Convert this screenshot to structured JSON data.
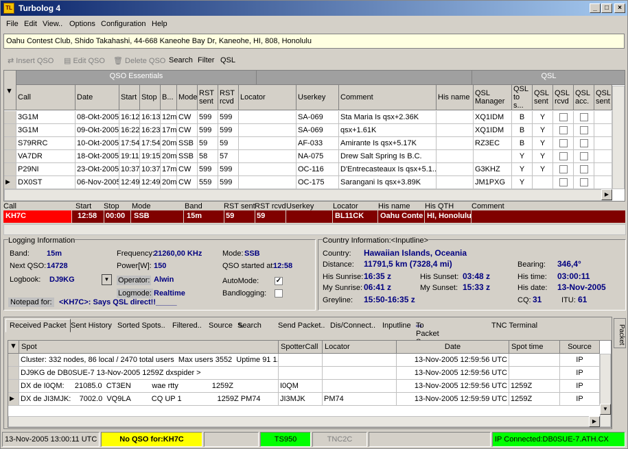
{
  "window": {
    "title": "Turbolog 4",
    "icon": "turbolog-app-icon",
    "minimize": "_",
    "maximize": "□",
    "close": "×"
  },
  "menu": [
    "File",
    "Edit",
    "View..",
    "Options",
    "Configuration",
    "Help"
  ],
  "address": "Oahu Contest Club, Shido Takahashi, 44-668 Kaneohe Bay Dr, Kaneohe, HI, 808, Honolulu",
  "toolbar": {
    "insert": "Insert QSO",
    "edit": "Edit QSO",
    "delete": "Delete QSO",
    "search": "Search",
    "filter": "Filter",
    "qsl": "QSL"
  },
  "qso_grid": {
    "groups": {
      "essentials": "QSO Essentials",
      "qsl": "QSL"
    },
    "columns": [
      "Call",
      "Date",
      "Start",
      "Stop",
      "B...",
      "Mode",
      "RST sent",
      "RST rcvd",
      "Locator",
      "Userkey",
      "Comment",
      "His name",
      "QSL Manager",
      "QSL to s...",
      "QSL sent",
      "QSL rcvd",
      "QSL acc.",
      "QSL sent"
    ],
    "rows": [
      {
        "call": "3G1M",
        "date": "08-Okt-2005",
        "start": "16:12",
        "stop": "16:13",
        "band": "12m",
        "mode": "CW",
        "rsts": "599",
        "rstr": "599",
        "loc": "",
        "userkey": "SA-069",
        "comment": "Sta Maria Is qsx+2.36K",
        "name": "",
        "mgr": "XQ1IDM",
        "qto": "B",
        "qsent": "Y"
      },
      {
        "call": "3G1M",
        "date": "09-Okt-2005",
        "start": "16:22",
        "stop": "16:23",
        "band": "17m",
        "mode": "CW",
        "rsts": "599",
        "rstr": "599",
        "loc": "",
        "userkey": "SA-069",
        "comment": "qsx+1.61K",
        "name": "",
        "mgr": "XQ1IDM",
        "qto": "B",
        "qsent": "Y"
      },
      {
        "call": "S79RRC",
        "date": "10-Okt-2005",
        "start": "17:54",
        "stop": "17:54",
        "band": "20m",
        "mode": "SSB",
        "rsts": "59",
        "rstr": "59",
        "loc": "",
        "userkey": "AF-033",
        "comment": "Amirante Is qsx+5.17K",
        "name": "",
        "mgr": "RZ3EC",
        "qto": "B",
        "qsent": "Y"
      },
      {
        "call": "VA7DR",
        "date": "18-Okt-2005",
        "start": "19:11",
        "stop": "19:15",
        "band": "20m",
        "mode": "SSB",
        "rsts": "58",
        "rstr": "57",
        "loc": "",
        "userkey": "NA-075",
        "comment": "Drew Salt Spring Is B.C.",
        "name": "",
        "mgr": "",
        "qto": "Y",
        "qsent": "Y"
      },
      {
        "call": "P29NI",
        "date": "23-Okt-2005",
        "start": "10:37",
        "stop": "10:37",
        "band": "17m",
        "mode": "CW",
        "rsts": "599",
        "rstr": "599",
        "loc": "",
        "userkey": "OC-116",
        "comment": "D'Entrecasteaux Is qsx+5.1...",
        "name": "",
        "mgr": "G3KHZ",
        "qto": "Y",
        "qsent": "Y"
      },
      {
        "call": "DX0ST",
        "date": "06-Nov-2005",
        "start": "12:49",
        "stop": "12:49",
        "band": "20m",
        "mode": "CW",
        "rsts": "559",
        "rstr": "599",
        "loc": "",
        "userkey": "OC-175",
        "comment": "Sarangani Is qsx+3.89K",
        "name": "",
        "mgr": "JM1PXG",
        "qto": "Y",
        "qsent": ""
      }
    ]
  },
  "entry": {
    "labels": [
      "Call",
      "Start",
      "Stop",
      "Mode",
      "Band",
      "RST sent",
      "RST rcvd",
      "Userkey",
      "Locator",
      "His name",
      "His QTH",
      "Comment"
    ],
    "values": [
      "KH7C",
      "12:58",
      "00:00",
      "SSB",
      "15m",
      "59",
      "59",
      "",
      "BL11CK",
      "Oahu Conte",
      "HI, Honolulu",
      ""
    ]
  },
  "logging": {
    "title": "Logging Information",
    "band_label": "Band:",
    "band": "15m",
    "next_label": "Next QSO:",
    "next": "14728",
    "logbook_label": "Logbook:",
    "logbook": "DJ9KG",
    "freq_label": "Frequency:",
    "freq": "21260,00  KHz",
    "power_label": "Power[W]:",
    "power": "150",
    "operator_label": "Operator:",
    "operator": "Alwin",
    "logmode_label": "Logmode:",
    "logmode": "Realtime",
    "mode_label": "Mode:",
    "mode": "SSB",
    "started_label": "QSO started at:",
    "started": "12:58",
    "automode_label": "AutoMode:",
    "bandlog_label": "Bandlogging:",
    "notepad_label": "Notepad for:",
    "notepad": "<KH7C>: Says QSL direct!!_____"
  },
  "country": {
    "title": "Country Information:<Inputline>",
    "country_label": "Country:",
    "country": "Hawaiian Islands, Oceania",
    "distance_label": "Distance:",
    "distance": "11791,5  km   (7328,4  mi)",
    "his_sunrise_label": "His Sunrise:",
    "his_sunrise": "16:35  z",
    "his_sunset_label": "His Sunset:",
    "his_sunset": "03:48  z",
    "my_sunrise_label": "My Sunrise:",
    "my_sunrise": "06:41  z",
    "my_sunset_label": "My Sunset:",
    "my_sunset": "15:33  z",
    "greyline_label": "Greyline:",
    "greyline": "15:50-16:35  z",
    "bearing_label": "Bearing:",
    "bearing": "346,4°",
    "histime_label": "His time:",
    "histime": "03:00:11",
    "hisdate_label": "His date:",
    "hisdate": "13-Nov-2005",
    "cq_label": "CQ:",
    "cq": "31",
    "itu_label": "ITU:",
    "itu": "61"
  },
  "packet": {
    "tabs": [
      "Received Packet",
      "Sent History",
      "Sorted Spots..",
      "Filtered..",
      "Source",
      "Search",
      "Send Packet..",
      "Dis/Connect..",
      "Inputline",
      "To Packet Screen",
      "TNC Terminal"
    ],
    "side_tab": "Packet",
    "columns": [
      "Spot",
      "SpotterCall",
      "Locator",
      "Date",
      "Spot time",
      "Source"
    ],
    "rows": [
      {
        "spot": "Cluster: 332 nodes, 86 local / 2470 total users  Max users 3552  Uptime 91 1...",
        "spotter": "",
        "loc": "",
        "date": "13-Nov-2005 12:59:56 UTC",
        "time": "",
        "src": "IP"
      },
      {
        "spot": "DJ9KG de DB0SUE-7 13-Nov-2005 1259Z dxspider >",
        "spotter": "",
        "loc": "",
        "date": "13-Nov-2005 12:59:56 UTC",
        "time": "",
        "src": "IP"
      },
      {
        "spot": "DX de I0QM:     21085.0  CT3EN          wae rtty                1259Z",
        "spotter": "I0QM",
        "loc": "",
        "date": "13-Nov-2005 12:59:56 UTC",
        "time": "1259Z",
        "src": "IP"
      },
      {
        "spot": "DX de JI3MJK:    7002.0  VQ9LA          CQ UP 1                 1259Z PM74",
        "spotter": "JI3MJK",
        "loc": "PM74",
        "date": "13-Nov-2005 12:59:59 UTC",
        "time": "1259Z",
        "src": "IP"
      }
    ]
  },
  "status": {
    "time": "13-Nov-2005  13:00:11 UTC",
    "noqso": "No QSO for:KH7C",
    "rig": "TS950",
    "tnc": "TNC2C",
    "ip": "IP Connected:DB0SUE-7.ATH.CX"
  },
  "colors": {
    "accent": "#000080",
    "entry_bg": "#800000",
    "call_bg": "#ff0000",
    "status_yellow": "#ffff00",
    "status_green": "#00ff00"
  }
}
